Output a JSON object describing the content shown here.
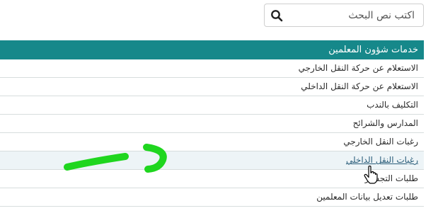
{
  "search": {
    "placeholder": "اكتب نص البحث",
    "icon": "search-icon"
  },
  "panel": {
    "title": "خدمات شؤون المعلمين",
    "header_color": "#16888a",
    "items": [
      {
        "label": "الاستعلام عن حركة النقل الخارجي"
      },
      {
        "label": "الاستعلام عن حركة النقل الداخلي"
      },
      {
        "label": "التكليف بالندب"
      },
      {
        "label": "المدارس والشرائح"
      },
      {
        "label": "رغبات النقل الخارجي"
      },
      {
        "label": "رغبات النقل الداخلي",
        "hovered": true
      },
      {
        "label": "طلبات التجسير"
      },
      {
        "label": "طلبات تعديل بيانات المعلمين"
      }
    ]
  },
  "annotation": {
    "type": "hand-drawn-arrow",
    "color": "#1fd61f",
    "direction": "right"
  },
  "cursor": {
    "type": "hand-pointer-icon"
  }
}
